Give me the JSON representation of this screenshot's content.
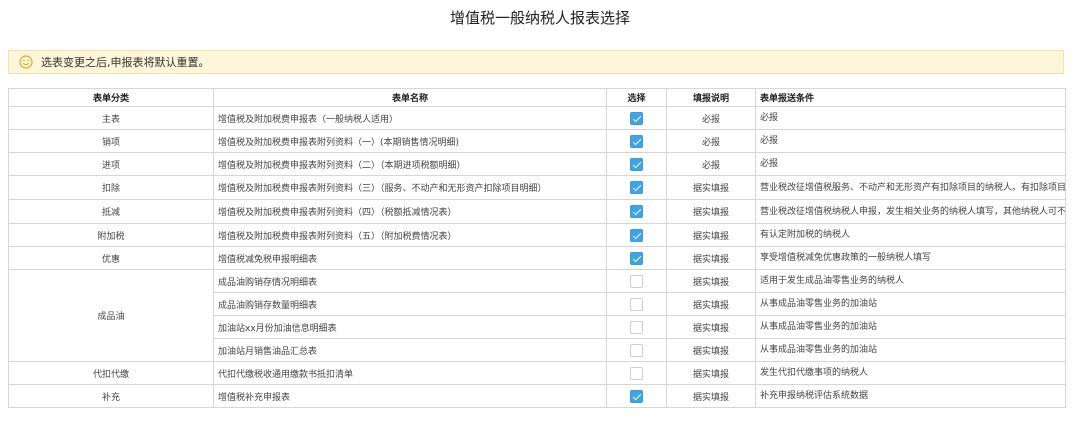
{
  "page_title": "增值税一般纳税人报表选择",
  "notice": {
    "icon": "smile-icon",
    "text": "选表变更之后,申报表将默认重置。",
    "color": "#fdf6db"
  },
  "table": {
    "headers": [
      "表单分类",
      "表单名称",
      "选择",
      "填报说明",
      "表单报送条件"
    ],
    "rows": [
      {
        "category": "主表",
        "name": "增值税及附加税费申报表（一般纳税人适用）",
        "checked": true,
        "fill": "必报",
        "condition": "必报"
      },
      {
        "category": "销项",
        "name": "增值税及附加税费申报表附列资料（一）(本期销售情况明细)",
        "checked": true,
        "fill": "必报",
        "condition": "必报"
      },
      {
        "category": "进项",
        "name": "增值税及附加税费申报表附列资料（二）（本期进项税额明细）",
        "checked": true,
        "fill": "必报",
        "condition": "必报"
      },
      {
        "category": "扣除",
        "name": "增值税及附加税费申报表附列资料（三）（服务、不动产和无形资产扣除项目明细）",
        "checked": true,
        "fill": "据实填报",
        "condition": "营业税改征增值税服务、不动产和无形资产有扣除项目的纳税人。有扣除项目的营业税改增值税纳税人填写，其他纳税人可不填。"
      },
      {
        "category": "抵减",
        "name": "增值税及附加税费申报表附列资料（四）（税额抵减情况表）",
        "checked": true,
        "fill": "据实填报",
        "condition": "营业税改征增值税纳税人申报，发生相关业务的纳税人填写，其他纳税人可不填"
      },
      {
        "category": "附加税",
        "name": "增值税及附加税费申报表附列资料（五）（附加税费情况表）",
        "checked": true,
        "fill": "据实填报",
        "condition": "有认定附加税的纳税人"
      },
      {
        "category": "优惠",
        "name": "增值税减免税申报明细表",
        "checked": true,
        "fill": "据实填报",
        "condition": "享受增值税减免优惠政策的一般纳税人填写"
      },
      {
        "category": "成品油",
        "name": "成品油购销存情况明细表",
        "checked": false,
        "fill": "据实填报",
        "condition": "适用于发生成品油零售业务的纳税人"
      },
      {
        "category": "",
        "name": "成品油购销存数量明细表",
        "checked": false,
        "fill": "据实填报",
        "condition": "从事成品油零售业务的加油站"
      },
      {
        "category": "",
        "name": "加油站xx月份加油信息明细表",
        "checked": false,
        "fill": "据实填报",
        "condition": "从事成品油零售业务的加油站"
      },
      {
        "category": "",
        "name": "加油站月销售油品汇总表",
        "checked": false,
        "fill": "据实填报",
        "condition": "从事成品油零售业务的加油站"
      },
      {
        "category": "代扣代缴",
        "name": "代扣代缴税收通用缴款书抵扣清单",
        "checked": false,
        "fill": "据实填报",
        "condition": "发生代扣代缴事项的纳税人"
      },
      {
        "category": "补充",
        "name": "增值税补充申报表",
        "checked": true,
        "fill": "据实填报",
        "condition": "补充申报纳税评估系统数据"
      }
    ]
  },
  "colors": {
    "checked": "#3fa3e8",
    "notice_bg": "#fdf6db"
  }
}
